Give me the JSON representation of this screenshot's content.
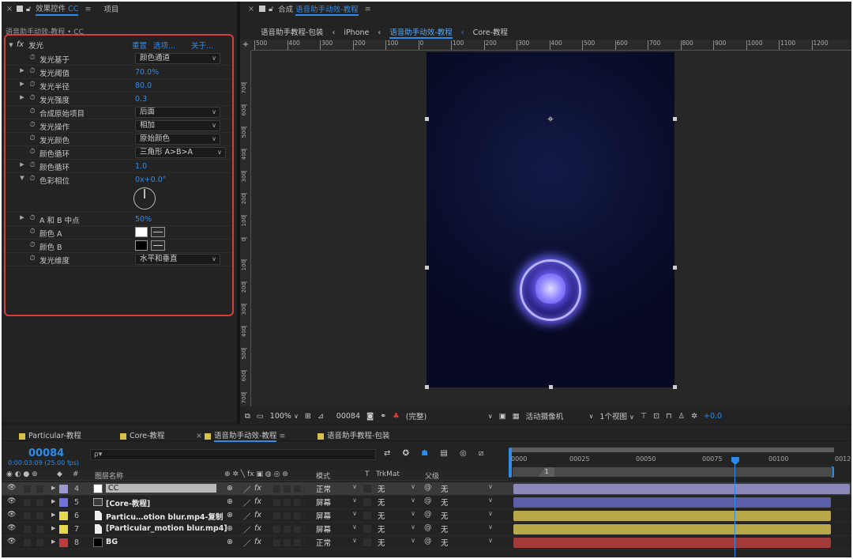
{
  "left_panel": {
    "tab_effects_label": "效果控件",
    "tab_effects_layer": "CC",
    "tab_project": "项目",
    "breadcrumb": "语音助手动效-教程 • CC",
    "effect_name": "发光",
    "effect_links": [
      "重置",
      "选项...",
      "关于..."
    ],
    "properties": [
      {
        "label": "发光基于",
        "kind": "dropdown",
        "value": "颜色通道",
        "expand": false
      },
      {
        "label": "发光阈值",
        "kind": "value",
        "value": "70.0%",
        "expand": true
      },
      {
        "label": "发光半径",
        "kind": "value",
        "value": "80.0",
        "expand": true
      },
      {
        "label": "发光强度",
        "kind": "value",
        "value": "0.3",
        "expand": true
      },
      {
        "label": "合成原始项目",
        "kind": "dropdown",
        "value": "后面",
        "expand": false
      },
      {
        "label": "发光操作",
        "kind": "dropdown",
        "value": "相加",
        "expand": false
      },
      {
        "label": "发光颜色",
        "kind": "dropdown",
        "value": "原始颜色",
        "expand": false
      },
      {
        "label": "颜色循环",
        "kind": "dropdown",
        "value": "三角形 A>B>A",
        "expand": false
      },
      {
        "label": "颜色循环",
        "kind": "value",
        "value": "1.0",
        "expand": true
      },
      {
        "label": "色彩相位",
        "kind": "value",
        "value": "0x+0.0°",
        "expand": true
      },
      {
        "label": "A 和 B 中点",
        "kind": "value",
        "value": "50%",
        "expand": true
      },
      {
        "label": "颜色 A",
        "kind": "color",
        "value": "#ffffff",
        "expand": false
      },
      {
        "label": "颜色 B",
        "kind": "color",
        "value": "#000000",
        "expand": false
      },
      {
        "label": "发光维度",
        "kind": "dropdown",
        "value": "水平和垂直",
        "expand": false
      }
    ]
  },
  "viewer": {
    "tab_prefix": "合成",
    "tab_comp": "语音助手动效-教程",
    "crumbs": [
      "语音助手教程-包装",
      "iPhone",
      "语音助手动效-教程",
      "Core-教程"
    ],
    "ruler_ticks": [
      "500",
      "400",
      "300",
      "200",
      "100",
      "0",
      "100",
      "200",
      "300",
      "400",
      "500",
      "600",
      "700",
      "800",
      "900",
      "1000",
      "1100",
      "1200"
    ],
    "vruler_ticks": [
      "700",
      "600",
      "500",
      "400",
      "300",
      "200",
      "100",
      "0",
      "100",
      "200",
      "300",
      "400",
      "500",
      "600",
      "700"
    ],
    "zoom": "100%",
    "timecode": "00084",
    "resolution": "(完整)",
    "camera": "活动摄像机",
    "views": "1个视图",
    "exposure": "+0.0"
  },
  "timeline": {
    "tabs": [
      {
        "label": "Particular-教程",
        "color": "#d9c04a",
        "active": false
      },
      {
        "label": "Core-教程",
        "color": "#d9c04a",
        "active": false
      },
      {
        "label": "语音助手动效-教程",
        "color": "#d9c04a",
        "active": true
      },
      {
        "label": "语音助手教程-包装",
        "color": "#d9c04a",
        "active": false
      }
    ],
    "current_frame": "00084",
    "timecode": "0:00:03:09 (25.00 fps)",
    "search_placeholder": "ρ▾",
    "ruler_labels": [
      "0000",
      "00025",
      "00050",
      "00075",
      "00100",
      "0012"
    ],
    "marker_label": "1",
    "col_num": "#",
    "col_name": "图层名称",
    "col_mode": "模式",
    "col_t": "T",
    "col_trkmat": "TrkMat",
    "col_parent": "父级",
    "playhead_fraction": 0.84,
    "layers": [
      {
        "num": "4",
        "name": "CC",
        "label_color": "#9b97d4",
        "swatch": "#ffffff",
        "mode": "正常",
        "trkmat": "无",
        "parent": "无",
        "bar_color": "#8a88b8",
        "selected": true
      },
      {
        "num": "5",
        "name": "[Core-教程]",
        "label_color": "#6f73d9",
        "swatch": "comp",
        "mode": "屏幕",
        "trkmat": "无",
        "parent": "无",
        "bar_color": "#5a5fa8",
        "selected": false
      },
      {
        "num": "6",
        "name": "Particu…otion blur.mp4-复制",
        "label_color": "#e6d84b",
        "swatch": "file",
        "mode": "屏幕",
        "trkmat": "无",
        "parent": "无",
        "bar_color": "#b8a84a",
        "selected": false
      },
      {
        "num": "7",
        "name": "[Particular_motion blur.mp4]",
        "label_color": "#e6d84b",
        "swatch": "file",
        "mode": "屏幕",
        "trkmat": "无",
        "parent": "无",
        "bar_color": "#b8a84a",
        "selected": false
      },
      {
        "num": "8",
        "name": "BG",
        "label_color": "#c23a3a",
        "swatch": "#000000",
        "mode": "正常",
        "trkmat": "无",
        "parent": "无",
        "bar_color": "#a33a3a",
        "selected": false
      }
    ]
  },
  "colors": {
    "accent": "#2d8ceb",
    "highlight_border": "#e0393b"
  }
}
